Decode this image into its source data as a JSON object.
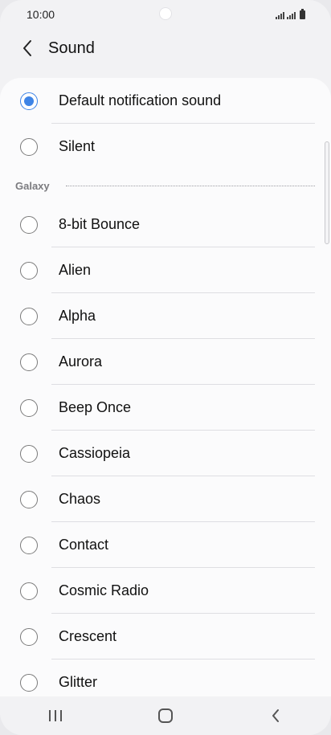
{
  "status_bar": {
    "time": "10:00"
  },
  "app_bar": {
    "title": "Sound"
  },
  "options_top": [
    {
      "label": "Default notification sound",
      "selected": true
    },
    {
      "label": "Silent",
      "selected": false
    }
  ],
  "section": {
    "title": "Galaxy"
  },
  "options_galaxy": [
    {
      "label": "8-bit Bounce",
      "selected": false
    },
    {
      "label": "Alien",
      "selected": false
    },
    {
      "label": "Alpha",
      "selected": false
    },
    {
      "label": "Aurora",
      "selected": false
    },
    {
      "label": "Beep Once",
      "selected": false
    },
    {
      "label": "Cassiopeia",
      "selected": false
    },
    {
      "label": "Chaos",
      "selected": false
    },
    {
      "label": "Contact",
      "selected": false
    },
    {
      "label": "Cosmic Radio",
      "selected": false
    },
    {
      "label": "Crescent",
      "selected": false
    },
    {
      "label": "Glitter",
      "selected": false
    }
  ],
  "colors": {
    "accent": "#3e84e6",
    "background": "#f2f2f4",
    "card": "#fbfbfc"
  },
  "icons": {
    "back": "chevron-left-icon",
    "recent": "recent-apps-icon",
    "home": "home-icon",
    "nav_back": "chevron-left-icon"
  }
}
